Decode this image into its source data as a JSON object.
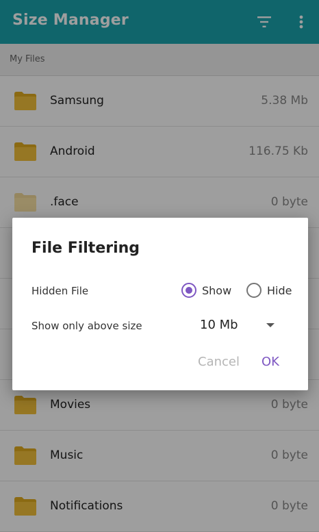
{
  "app": {
    "title": "Size Manager",
    "accent_color": "#1aa3ad",
    "icons": [
      "filter-icon",
      "more-vertical-icon"
    ]
  },
  "breadcrumb": "My Files",
  "files": [
    {
      "name": "Samsung",
      "size": "5.38 Mb",
      "icon": "folder-icon"
    },
    {
      "name": "Android",
      "size": "116.75 Kb",
      "icon": "folder-icon"
    },
    {
      "name": ".face",
      "size": "0 byte",
      "icon": "folder-icon"
    },
    {
      "name": "",
      "size": "",
      "icon": "folder-icon"
    },
    {
      "name": "",
      "size": "",
      "icon": "folder-icon"
    },
    {
      "name": "",
      "size": "",
      "icon": "folder-icon"
    },
    {
      "name": "Movies",
      "size": "0 byte",
      "icon": "folder-icon"
    },
    {
      "name": "Music",
      "size": "0 byte",
      "icon": "folder-icon"
    },
    {
      "name": "Notifications",
      "size": "0 byte",
      "icon": "folder-icon"
    }
  ],
  "dialog": {
    "title": "File Filtering",
    "hidden_file_label": "Hidden File",
    "show_label": "Show",
    "hide_label": "Hide",
    "selected": "Show",
    "size_label": "Show only above size",
    "size_value": "10 Mb",
    "cancel_label": "Cancel",
    "ok_label": "OK",
    "radio_color": "#7e57c2"
  }
}
